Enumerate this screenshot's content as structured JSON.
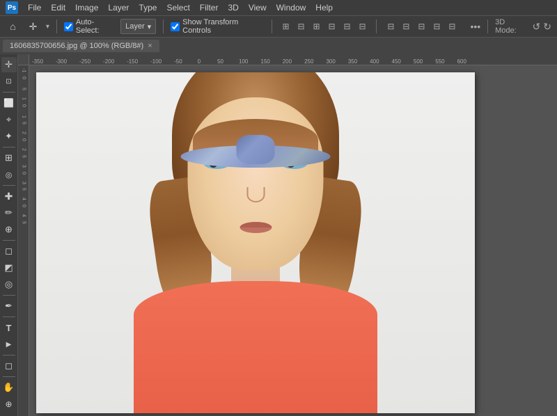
{
  "app": {
    "logo": "Ps",
    "title": "Adobe Photoshop"
  },
  "menubar": {
    "items": [
      "File",
      "Edit",
      "Image",
      "Layer",
      "Type",
      "Select",
      "Filter",
      "3D",
      "View",
      "Window",
      "Help"
    ]
  },
  "optionsbar": {
    "move_icon": "✛",
    "auto_select_label": "Auto-Select:",
    "layer_dropdown": "Layer",
    "show_transform_label": "Show Transform Controls",
    "align_icons": [
      "⬛",
      "⬜",
      "⬜",
      "⬜",
      "⬜",
      "⬜"
    ],
    "more_icon": "•••",
    "mode_3d_label": "3D Mode:",
    "chevron_down": "▾"
  },
  "doctab": {
    "filename": "1606835700656.jpg @ 100% (RGB/8#)",
    "close": "×"
  },
  "toolbar": {
    "tools": [
      {
        "name": "move",
        "icon": "✛"
      },
      {
        "name": "artboard",
        "icon": "⊡"
      },
      {
        "name": "rect-select",
        "icon": "⬜"
      },
      {
        "name": "lasso",
        "icon": "⌖"
      },
      {
        "name": "wand",
        "icon": "✦"
      },
      {
        "name": "crop",
        "icon": "⊞"
      },
      {
        "name": "eyedropper",
        "icon": "⊘"
      },
      {
        "name": "healing",
        "icon": "✚"
      },
      {
        "name": "brush",
        "icon": "✏"
      },
      {
        "name": "stamp",
        "icon": "⊕"
      },
      {
        "name": "eraser",
        "icon": "◻"
      },
      {
        "name": "gradient",
        "icon": "◩"
      },
      {
        "name": "dodge",
        "icon": "◎"
      },
      {
        "name": "pen",
        "icon": "✒"
      },
      {
        "name": "type",
        "icon": "T"
      },
      {
        "name": "selection",
        "icon": "▶"
      },
      {
        "name": "shape",
        "icon": "◻"
      },
      {
        "name": "hand",
        "icon": "✋"
      },
      {
        "name": "zoom",
        "icon": "🔍"
      }
    ]
  },
  "ruler": {
    "top_marks": [
      "-350",
      "-300",
      "-250",
      "-200",
      "-150",
      "-100",
      "-50",
      "0",
      "50",
      "100",
      "150",
      "200",
      "250",
      "300",
      "350",
      "400",
      "450",
      "500",
      "550",
      "600"
    ],
    "left_marks": [
      "-1",
      "0",
      "5",
      "1",
      "0",
      "1",
      "5",
      "2",
      "0",
      "2",
      "5",
      "3",
      "0",
      "3",
      "5",
      "4",
      "0",
      "4",
      "5"
    ]
  },
  "canvas": {
    "zoom": "100%",
    "mode": "RGB/8#"
  }
}
